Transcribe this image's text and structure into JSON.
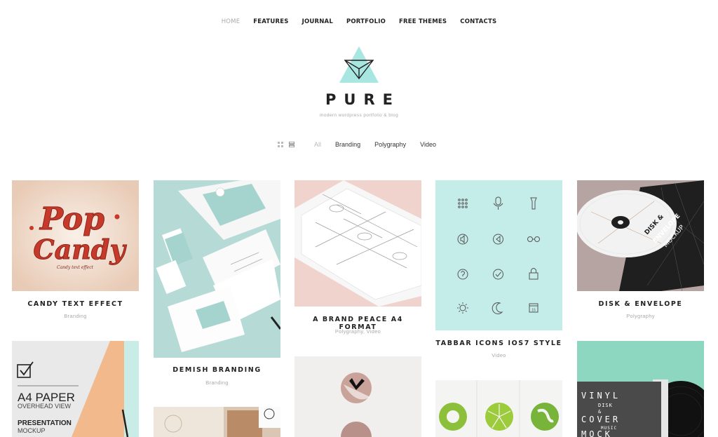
{
  "nav": {
    "items": [
      "HOME",
      "FEATURES",
      "JOURNAL",
      "PORTFOLIO",
      "FREE THEMES",
      "CONTACTS"
    ]
  },
  "brand": {
    "name": "PURE",
    "tagline": "modern wordpress portfolio & blog",
    "accent": "#a8e6e2"
  },
  "filters": {
    "items": [
      "All",
      "Branding",
      "Polygraphy",
      "Video"
    ]
  },
  "portfolio": [
    {
      "title": "CANDY TEXT EFFECT",
      "category": "Branding",
      "art_line1": "Pop",
      "art_line2": "Candy",
      "art_caption": "Candy text effect"
    },
    {
      "title": "DEMISH BRANDING",
      "category": "Branding"
    },
    {
      "title": "A BRAND PEACE A4 FORMAT",
      "category": "Polygraphy, Video"
    },
    {
      "title": "TABBAR ICONS IOS7 STYLE",
      "category": "Video"
    },
    {
      "title": "DISK & ENVELOPE",
      "category": "Polygraphy"
    },
    {
      "art_line1": "A4 PAPER",
      "art_line2": "OVERHEAD VIEW",
      "art_line3": "PRESENTATION",
      "art_line4": "MOCKUP"
    },
    {
      "art_line1": "VINYL",
      "art_line2": "DISK",
      "art_line3": "COVER",
      "art_line4": "MUSIC",
      "art_line5": "MOCK"
    }
  ]
}
